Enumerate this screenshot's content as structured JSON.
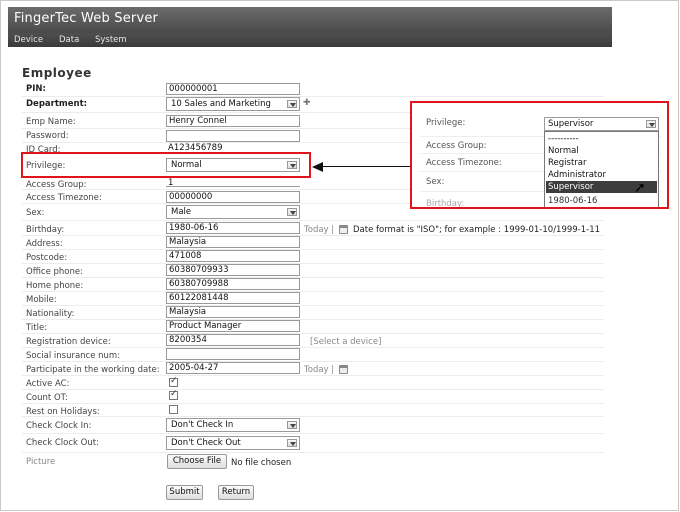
{
  "app": {
    "title": "FingerTec Web Server",
    "nav": [
      "Device",
      "Data",
      "System"
    ]
  },
  "page_title": "Employee",
  "form": {
    "pin": {
      "label": "PIN:",
      "value": "000000001"
    },
    "department": {
      "label": "Department:",
      "value": "10 Sales and Marketing"
    },
    "emp_name": {
      "label": "Emp Name:",
      "value": "Henry Connel"
    },
    "password": {
      "label": "Password:",
      "value": ""
    },
    "id_card": {
      "label": "ID Card:",
      "value": "A123456789"
    },
    "privilege": {
      "label": "Privilege:",
      "value": "Normal"
    },
    "access_group": {
      "label": "Access Group:",
      "value": "1"
    },
    "access_timezone": {
      "label": "Access Timezone:",
      "value": "00000000"
    },
    "sex": {
      "label": "Sex:",
      "value": "Male"
    },
    "birthday": {
      "label": "Birthday:",
      "value": "1980-06-16",
      "today": "Today |",
      "format_note": "Date format is \"ISO\"; for example : 1999-01-10/1999-1-11"
    },
    "address": {
      "label": "Address:",
      "value": "Malaysia"
    },
    "postcode": {
      "label": "Postcode:",
      "value": "471008"
    },
    "office_phone": {
      "label": "Office phone:",
      "value": "60380709933"
    },
    "home_phone": {
      "label": "Home phone:",
      "value": "60380709988"
    },
    "mobile": {
      "label": "Mobile:",
      "value": "60122081448"
    },
    "nationality": {
      "label": "Nationality:",
      "value": "Malaysia"
    },
    "title": {
      "label": "Title:",
      "value": "Product Manager"
    },
    "registration_device": {
      "label": "Registration device:",
      "value": "8200354",
      "link": "[Select a device]"
    },
    "social_insurance": {
      "label": "Social insurance num:",
      "value": ""
    },
    "working_date": {
      "label": "Participate in the working date:",
      "value": "2005-04-27",
      "today": "Today |"
    },
    "active_ac": {
      "label": "Active AC:",
      "checked": true
    },
    "count_ot": {
      "label": "Count OT:",
      "checked": true
    },
    "rest_holidays": {
      "label": "Rest on Holidays:",
      "checked": false
    },
    "check_in": {
      "label": "Check Clock In:",
      "value": "Don't Check In"
    },
    "check_out": {
      "label": "Check Clock Out:",
      "value": "Don't Check Out"
    },
    "picture": {
      "label": "Picture",
      "button": "Choose File",
      "status": "No file chosen"
    }
  },
  "buttons": {
    "submit": "Submit",
    "return": "Return"
  },
  "callout": {
    "privilege_label": "Privilege:",
    "selected": "Supervisor",
    "access_group_label": "Access Group:",
    "access_timezone_label": "Access Timezone:",
    "sex_label": "Sex:",
    "birthday_label": "Birthday:",
    "options": [
      "----------",
      "Normal",
      "Registrar",
      "Administrator",
      "Supervisor",
      "1980-06-16"
    ]
  },
  "colors": {
    "highlight": "#e0141b",
    "titlebar": "#555555"
  }
}
